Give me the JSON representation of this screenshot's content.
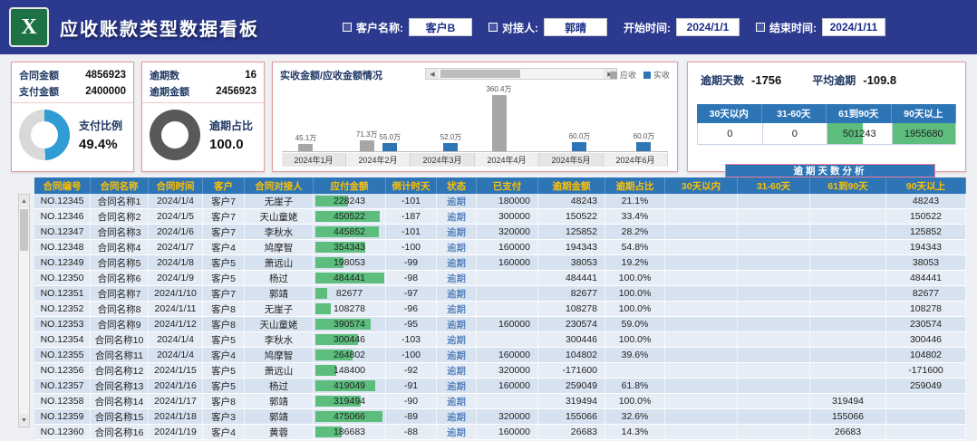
{
  "colors": {
    "header_bg": "#2b3a8f",
    "table_header_bg": "#2e75b6",
    "table_header_text": "#ffc000",
    "bar_green": "#5cbd7d",
    "receivable_gray": "#a6a6a6",
    "received_blue": "#2e75b6",
    "card_border": "#e59a9a",
    "banner_border": "#f07ba0"
  },
  "header": {
    "title": "应收账款类型数据看板",
    "filters": {
      "customer_label": "客户名称:",
      "customer_value": "客户B",
      "contact_label": "对接人:",
      "contact_value": "郭晴",
      "start_label": "开始时间:",
      "start_value": "2024/1/1",
      "end_label": "结束时间:",
      "end_value": "2024/1/11"
    }
  },
  "kpi_cards": {
    "contract": {
      "label1": "合同金额",
      "value1": "4856923",
      "label2": "支付金额",
      "value2": "2400000",
      "donut_label": "支付比例",
      "donut_value": "49.4%",
      "percent": 49.4,
      "donut_colors": [
        "#2f9cd4",
        "#d9d9d9"
      ]
    },
    "overdue": {
      "label1": "逾期数",
      "value1": "16",
      "label2": "逾期金额",
      "value2": "2456923",
      "donut_label": "逾期占比",
      "donut_value": "100.0",
      "percent": 100,
      "donut_colors": [
        "#595959",
        "#d9d9d9"
      ]
    }
  },
  "chart_card": {
    "title": "实收金额/应收金额情况",
    "legend": [
      {
        "label": "应收",
        "color": "#a6a6a6"
      },
      {
        "label": "实收",
        "color": "#2e75b6"
      }
    ]
  },
  "chart_data": {
    "type": "bar",
    "title": "实收金额/应收金额情况",
    "categories": [
      "2024年1月",
      "2024年2月",
      "2024年3月",
      "2024年4月",
      "2024年5月",
      "2024年6月"
    ],
    "series": [
      {
        "name": "应收",
        "color": "#a6a6a6",
        "values": [
          45.1,
          71.3,
          0,
          360.4,
          0,
          0
        ]
      },
      {
        "name": "实收",
        "color": "#2e75b6",
        "values": [
          0,
          55.0,
          52.0,
          0,
          60.0,
          60.0
        ]
      }
    ],
    "labels": [
      [
        "45.1万",
        "71.3万",
        "",
        "360.4万",
        "",
        ""
      ],
      [
        "",
        "55.0万",
        "52.0万",
        "",
        "60.0万",
        "60.0万"
      ]
    ],
    "unit": "万",
    "ylim": [
      0,
      400
    ],
    "legend_position": "top-right",
    "grid": false
  },
  "summary_card": {
    "days_label": "逾期天数",
    "days_value": "-1756",
    "avg_label": "平均逾期",
    "avg_value": "-109.8",
    "bucket_headers": [
      "30天以内",
      "31-60天",
      "61到90天",
      "90天以上"
    ],
    "bucket_values": [
      "0",
      "0",
      "501243",
      "1955680"
    ],
    "bucket_bar_widths": [
      0,
      0,
      55,
      100
    ]
  },
  "table": {
    "analysis_banner": "逾期天数分析",
    "headers": [
      "合同编号",
      "合同名称",
      "合同时间",
      "客户",
      "合同对接人",
      "应付金额",
      "倒计时天",
      "状态",
      "已支付",
      "逾期金额",
      "逾期占比",
      "30天以内",
      "31-60天",
      "61到90天",
      "90天以上"
    ],
    "rows": [
      [
        "NO.12345",
        "合同名称1",
        "2024/1/4",
        "客户7",
        "无崖子",
        "228243",
        "-101",
        "逾期",
        "180000",
        "48243",
        "21.1%",
        "",
        "",
        "",
        "48243"
      ],
      [
        "NO.12346",
        "合同名称2",
        "2024/1/5",
        "客户7",
        "天山童姥",
        "450522",
        "-187",
        "逾期",
        "300000",
        "150522",
        "33.4%",
        "",
        "",
        "",
        "150522"
      ],
      [
        "NO.12347",
        "合同名称3",
        "2024/1/6",
        "客户7",
        "李秋水",
        "445852",
        "-101",
        "逾期",
        "320000",
        "125852",
        "28.2%",
        "",
        "",
        "",
        "125852"
      ],
      [
        "NO.12348",
        "合同名称4",
        "2024/1/7",
        "客户4",
        "鸠摩智",
        "354343",
        "-100",
        "逾期",
        "160000",
        "194343",
        "54.8%",
        "",
        "",
        "",
        "194343"
      ],
      [
        "NO.12349",
        "合同名称5",
        "2024/1/8",
        "客户5",
        "萧远山",
        "198053",
        "-99",
        "逾期",
        "160000",
        "38053",
        "19.2%",
        "",
        "",
        "",
        "38053"
      ],
      [
        "NO.12350",
        "合同名称6",
        "2024/1/9",
        "客户5",
        "杨过",
        "484441",
        "-98",
        "逾期",
        "",
        "484441",
        "100.0%",
        "",
        "",
        "",
        "484441"
      ],
      [
        "NO.12351",
        "合同名称7",
        "2024/1/10",
        "客户7",
        "郭靖",
        "82677",
        "-97",
        "逾期",
        "",
        "82677",
        "100.0%",
        "",
        "",
        "",
        "82677"
      ],
      [
        "NO.12352",
        "合同名称8",
        "2024/1/11",
        "客户8",
        "无崖子",
        "108278",
        "-96",
        "逾期",
        "",
        "108278",
        "100.0%",
        "",
        "",
        "",
        "108278"
      ],
      [
        "NO.12353",
        "合同名称9",
        "2024/1/12",
        "客户8",
        "天山童姥",
        "390574",
        "-95",
        "逾期",
        "160000",
        "230574",
        "59.0%",
        "",
        "",
        "",
        "230574"
      ],
      [
        "NO.12354",
        "合同名称10",
        "2024/1/4",
        "客户5",
        "李秋水",
        "300446",
        "-103",
        "逾期",
        "",
        "300446",
        "100.0%",
        "",
        "",
        "",
        "300446"
      ],
      [
        "NO.12355",
        "合同名称11",
        "2024/1/4",
        "客户4",
        "鸠摩智",
        "264802",
        "-100",
        "逾期",
        "160000",
        "104802",
        "39.6%",
        "",
        "",
        "",
        "104802"
      ],
      [
        "NO.12356",
        "合同名称12",
        "2024/1/15",
        "客户5",
        "萧远山",
        "148400",
        "-92",
        "逾期",
        "320000",
        "-171600",
        "",
        "",
        "",
        "",
        "-171600"
      ],
      [
        "NO.12357",
        "合同名称13",
        "2024/1/16",
        "客户5",
        "杨过",
        "419049",
        "-91",
        "逾期",
        "160000",
        "259049",
        "61.8%",
        "",
        "",
        "",
        "259049"
      ],
      [
        "NO.12358",
        "合同名称14",
        "2024/1/17",
        "客户8",
        "郭靖",
        "319494",
        "-90",
        "逾期",
        "",
        "319494",
        "100.0%",
        "",
        "",
        "319494",
        ""
      ],
      [
        "NO.12359",
        "合同名称15",
        "2024/1/18",
        "客户3",
        "郭靖",
        "475066",
        "-89",
        "逾期",
        "320000",
        "155066",
        "32.6%",
        "",
        "",
        "155066",
        ""
      ],
      [
        "NO.12360",
        "合同名称16",
        "2024/1/19",
        "客户4",
        "黄蓉",
        "186683",
        "-88",
        "逾期",
        "160000",
        "26683",
        "14.3%",
        "",
        "",
        "26683",
        ""
      ]
    ]
  },
  "scrollbar": {
    "left_glyph": "◀",
    "right_glyph": "▶",
    "up_glyph": "▲",
    "down_glyph": "▼"
  }
}
